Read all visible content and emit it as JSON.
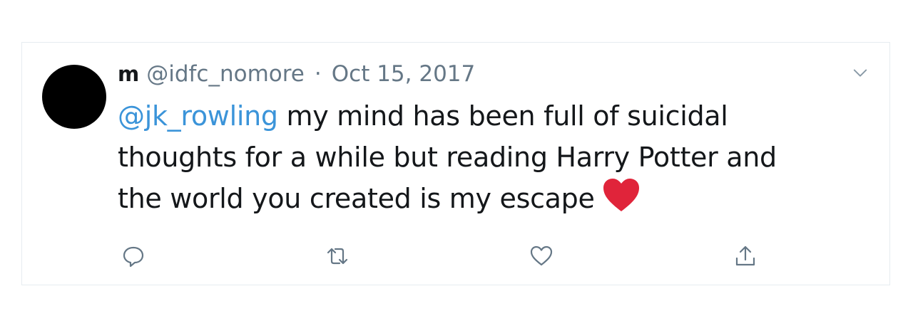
{
  "tweet": {
    "display_name": "m",
    "handle": "@idfc_nomore",
    "separator": "·",
    "date": "Oct 15, 2017",
    "mention": "@jk_rowling",
    "body": " my mind has been full of suicidal thoughts for a while but reading Harry Potter and the world you created is my escape",
    "emoji": "red-heart-emoji"
  },
  "icons": {
    "menu": "chevron-down-icon",
    "reply": "reply-icon",
    "retweet": "retweet-icon",
    "like": "like-icon",
    "share": "share-icon"
  },
  "colors": {
    "mention": "#3b94d9",
    "muted": "#657786",
    "text": "#14171a",
    "heart": "#e0243a"
  }
}
